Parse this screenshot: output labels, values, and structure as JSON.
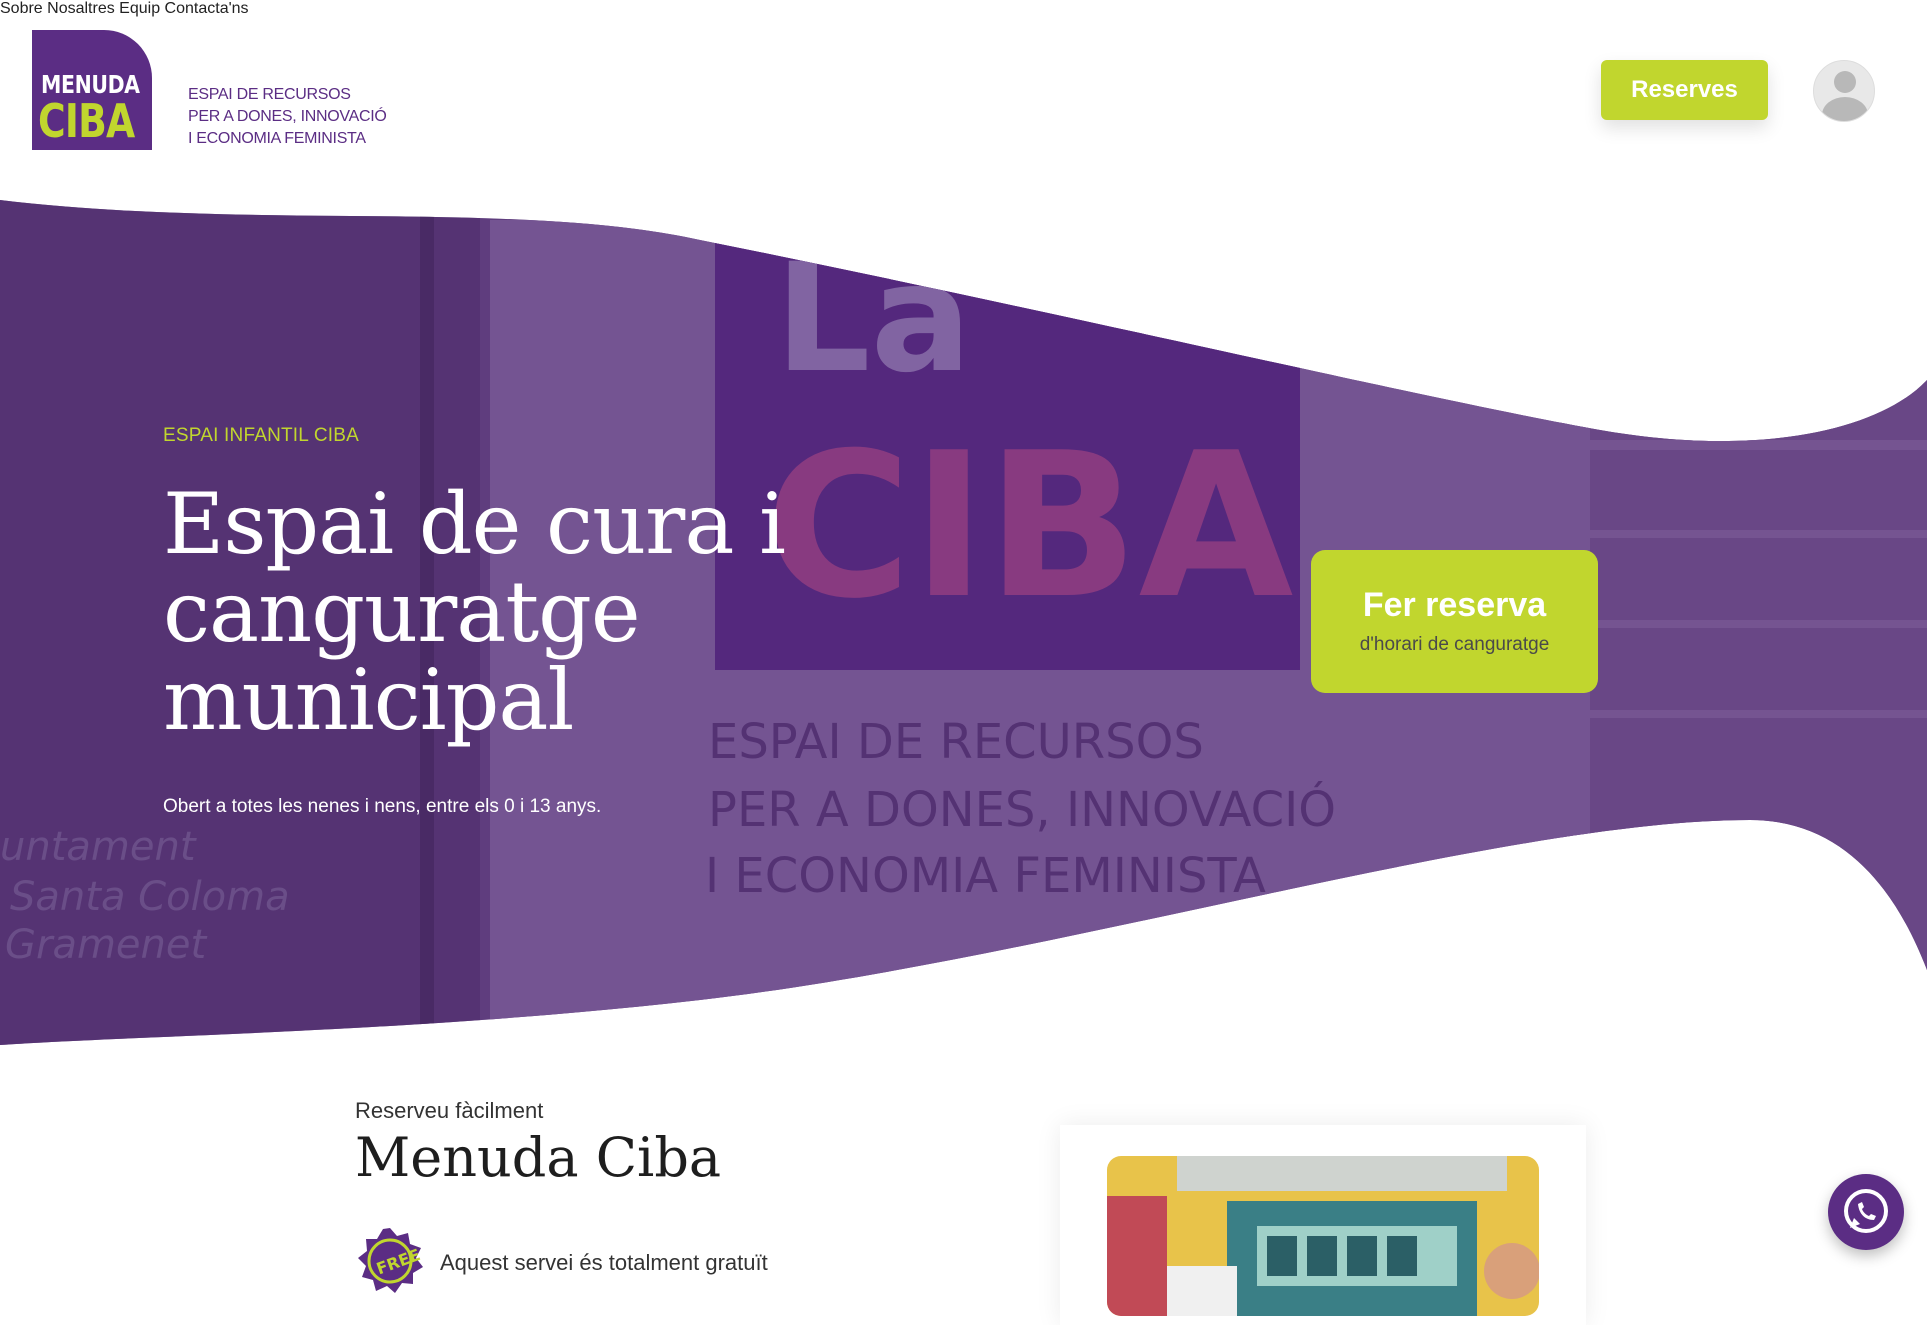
{
  "header": {
    "logo": {
      "line1": "MENUDA",
      "line2": "CIBA"
    },
    "tagline": [
      "ESPAI DE RECURSOS",
      "PER A DONES, INNOVACIÓ",
      "I ECONOMIA FEMINISTA"
    ],
    "nav": [
      "Sobre Nosaltres",
      "Equip",
      "Contacta'ns"
    ],
    "reserves_button": "Reserves"
  },
  "hero": {
    "eyebrow": "ESPAI INFANTIL CIBA",
    "title_lines": [
      "Espai de cura i",
      "canguratge",
      "municipal"
    ],
    "subtitle": "Obert a totes les nenes i nens, entre els 0 i 13 anys.",
    "cta_main": "Fer reserva",
    "cta_sub": "d'horari de canguratge",
    "background_sign": {
      "top": "La",
      "main": "CIBA",
      "lines": [
        "ESPAI DE RECURSOS",
        "PER A DONES, INNOVACIÓ",
        "I ECONOMIA FEMINISTA"
      ],
      "left_text": [
        "untament",
        "Santa Coloma",
        "Gramenet"
      ]
    }
  },
  "section": {
    "eyebrow": "Reserveu fàcilment",
    "title": "Menuda Ciba",
    "badge_text": "FREE",
    "service_text": "Aquest servei és totalment gratuït"
  },
  "colors": {
    "purple": "#5b2d84",
    "lime": "#c1d62e",
    "hero_overlay": "#4b2470"
  },
  "icons": {
    "avatar": "user-avatar-icon",
    "whatsapp": "whatsapp-icon",
    "badge": "free-badge-icon"
  }
}
